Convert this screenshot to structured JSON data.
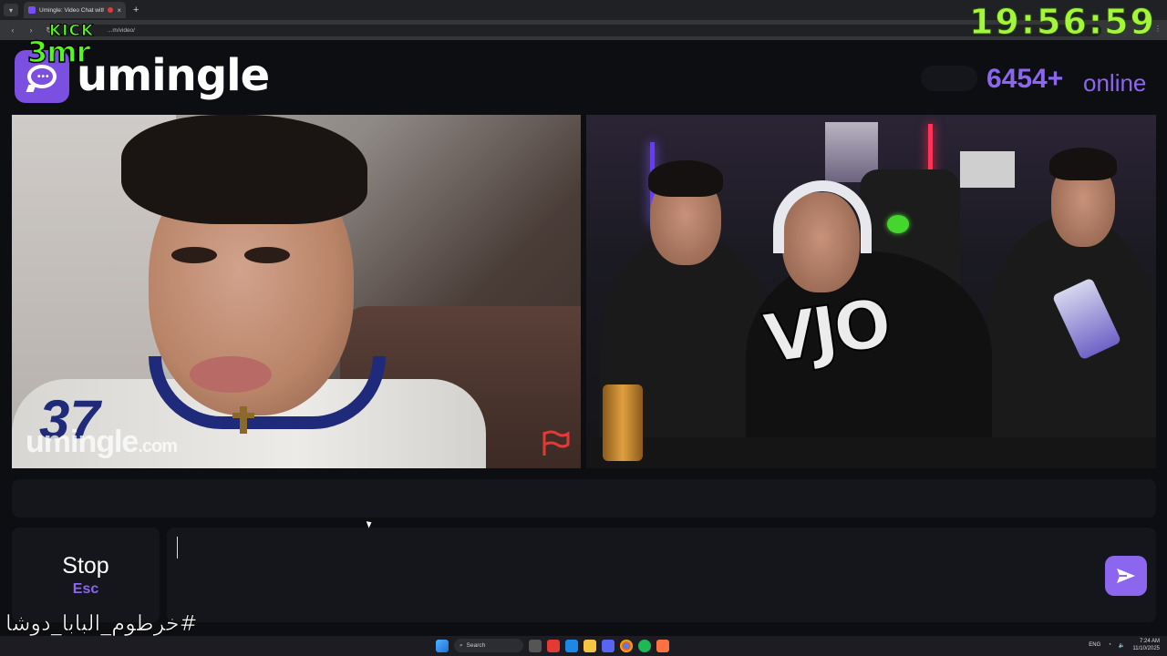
{
  "browser": {
    "tab_title": "Umingle: Video Chat with S",
    "tab_close": "×",
    "new_tab": "+",
    "url": "...m/video/",
    "back": "‹",
    "forward": "›",
    "reload": "↻"
  },
  "stream_overlay": {
    "platform": "KICK",
    "streamer": "3mr",
    "clock": "19:56:59",
    "hashtag": "#خرطوم_البابا_دوشا"
  },
  "site": {
    "brand": "umingle",
    "online_count": "6454+",
    "online_label": "online",
    "watermark_main": "umingle",
    "watermark_tld": ".com",
    "stranger_jersey": "37",
    "streamer_shirt": "VJO"
  },
  "controls": {
    "stop_label": "Stop",
    "stop_key": "Esc",
    "chat_value": ""
  },
  "taskbar": {
    "search": "Search",
    "lang": "ENG",
    "time": "7:24 AM",
    "date": "11/10/2025"
  },
  "colors": {
    "accent": "#8c66ee",
    "kick_green": "#53fc18",
    "clock_green": "#a4f63a",
    "panel": "#15161b",
    "background": "#0d0e12"
  }
}
